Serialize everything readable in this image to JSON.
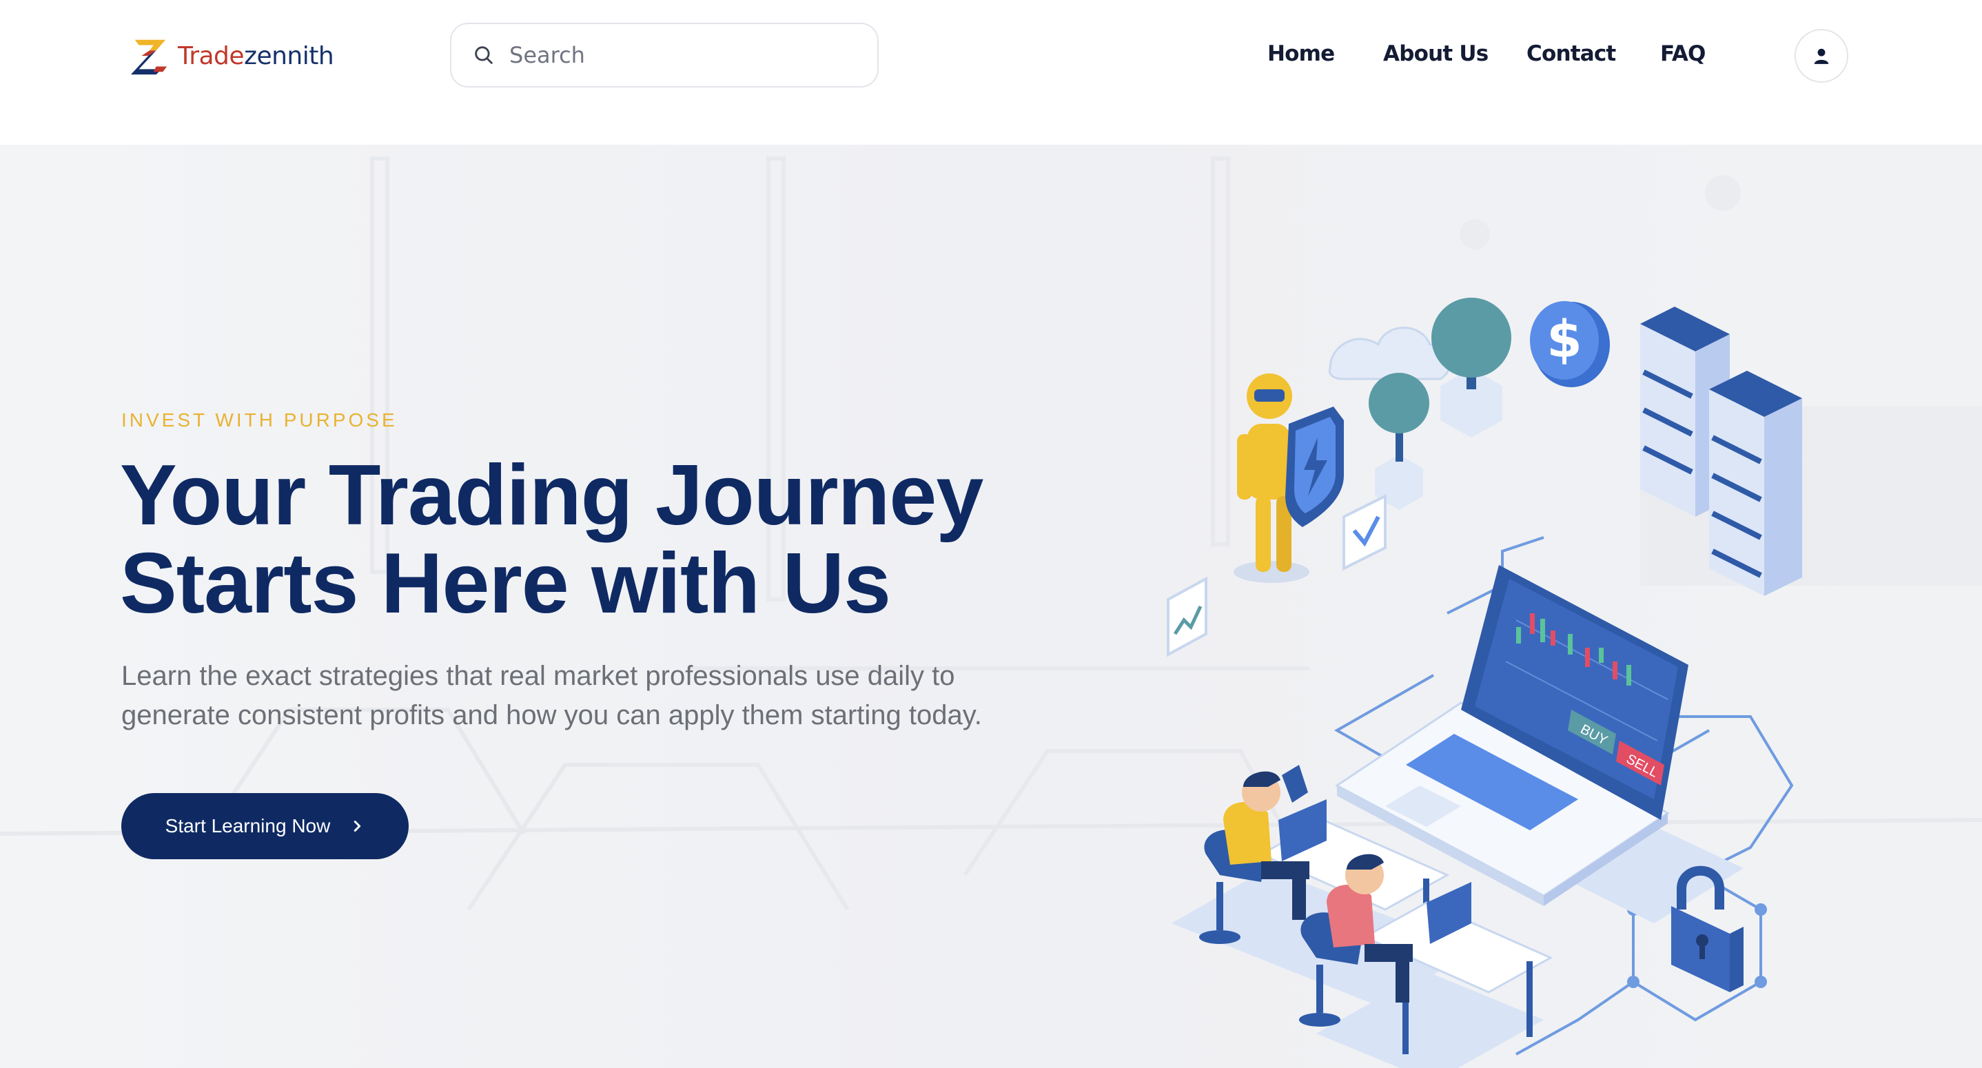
{
  "header": {
    "logo": {
      "part1": "Trade",
      "part2": "zennith"
    },
    "search": {
      "placeholder": "Search"
    },
    "nav": [
      "Home",
      "About Us",
      "Contact",
      "FAQ"
    ],
    "account_icon": "user-icon"
  },
  "hero": {
    "eyebrow": "INVEST WITH PURPOSE",
    "headline_line1": "Your Trading Journey",
    "headline_line2": "Starts Here with Us",
    "subtext_line1": "Learn the exact strategies that real market professionals use daily to",
    "subtext_line2": "generate consistent profits and how you can apply them starting today.",
    "cta_label": "Start Learning Now",
    "cta_icon": "chevron-right-icon",
    "illustration": {
      "buy_label": "BUY",
      "sell_label": "SELL",
      "currency_symbol": "$"
    }
  },
  "colors": {
    "brand_navy": "#0f2a63",
    "accent_yellow": "#e9b232",
    "logo_red": "#c0392b",
    "hero_bg": "#f3f4f6"
  }
}
